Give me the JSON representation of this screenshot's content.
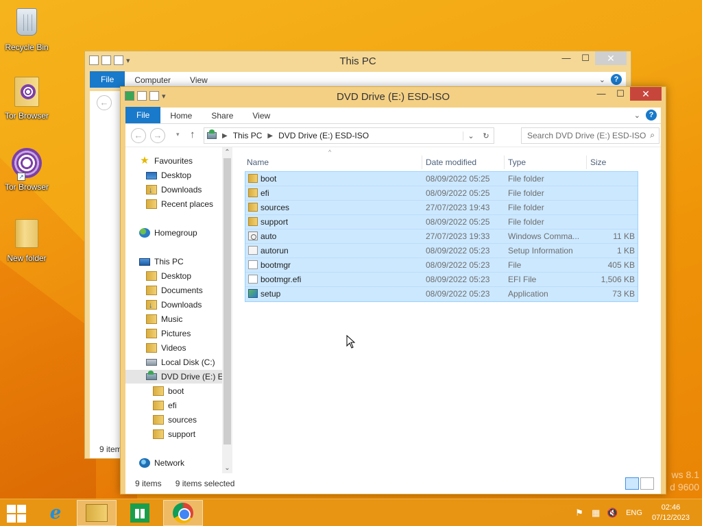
{
  "desktop": {
    "icons": [
      {
        "label": "Recycle Bin",
        "icon": "recycle-bin-icon"
      },
      {
        "label": "Tor Browser",
        "icon": "tor-browser-folder-icon"
      },
      {
        "label": "Tor Browser",
        "icon": "tor-browser-icon"
      },
      {
        "label": "New folder",
        "icon": "folder-icon"
      }
    ],
    "watermark_line1": "ws 8.1",
    "watermark_line2": "d 9600"
  },
  "back_window": {
    "title": "This PC",
    "tabs": [
      "File",
      "Computer",
      "View"
    ],
    "status": "9 item"
  },
  "window": {
    "title": "DVD Drive (E:) ESD-ISO",
    "controls": {
      "minimize": "—",
      "maximize": "☐",
      "close": "✕"
    },
    "tabs": {
      "file": "File",
      "home": "Home",
      "share": "Share",
      "view": "View"
    },
    "address": {
      "crumb1": "This PC",
      "crumb2": "DVD Drive (E:) ESD-ISO"
    },
    "search_placeholder": "Search DVD Drive (E:) ESD-ISO",
    "nav": {
      "favourites": "Favourites",
      "desktop": "Desktop",
      "downloads": "Downloads",
      "recent": "Recent places",
      "homegroup": "Homegroup",
      "thispc": "This PC",
      "pc_desktop": "Desktop",
      "documents": "Documents",
      "pc_downloads": "Downloads",
      "music": "Music",
      "pictures": "Pictures",
      "videos": "Videos",
      "localdisk": "Local Disk (C:)",
      "dvd": "DVD Drive (E:) ES",
      "boot": "boot",
      "efi": "efi",
      "sources": "sources",
      "support": "support",
      "network": "Network"
    },
    "columns": {
      "name": "Name",
      "date": "Date modified",
      "type": "Type",
      "size": "Size"
    },
    "files": [
      {
        "name": "boot",
        "date": "08/09/2022 05:25",
        "type": "File folder",
        "size": "",
        "icon": "folder-icon"
      },
      {
        "name": "efi",
        "date": "08/09/2022 05:25",
        "type": "File folder",
        "size": "",
        "icon": "folder-icon"
      },
      {
        "name": "sources",
        "date": "27/07/2023 19:43",
        "type": "File folder",
        "size": "",
        "icon": "folder-icon"
      },
      {
        "name": "support",
        "date": "08/09/2022 05:25",
        "type": "File folder",
        "size": "",
        "icon": "folder-icon"
      },
      {
        "name": "auto",
        "date": "27/07/2023 19:33",
        "type": "Windows Comma...",
        "size": "11 KB",
        "icon": "command-script-icon"
      },
      {
        "name": "autorun",
        "date": "08/09/2022 05:23",
        "type": "Setup Information",
        "size": "1 KB",
        "icon": "setup-info-icon"
      },
      {
        "name": "bootmgr",
        "date": "08/09/2022 05:23",
        "type": "File",
        "size": "405 KB",
        "icon": "file-icon"
      },
      {
        "name": "bootmgr.efi",
        "date": "08/09/2022 05:23",
        "type": "EFI File",
        "size": "1,506 KB",
        "icon": "file-icon"
      },
      {
        "name": "setup",
        "date": "08/09/2022 05:23",
        "type": "Application",
        "size": "73 KB",
        "icon": "application-icon"
      }
    ],
    "status": {
      "items": "9 items",
      "selected": "9 items selected"
    }
  },
  "taskbar": {
    "language": "ENG",
    "time": "02:46",
    "date": "07/12/2023"
  }
}
